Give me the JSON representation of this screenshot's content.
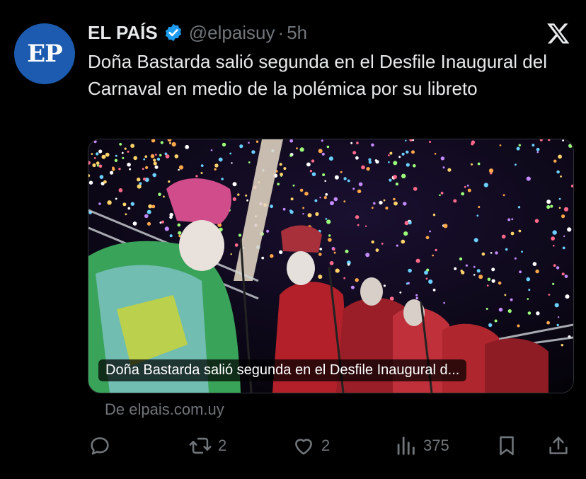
{
  "tweet": {
    "avatar_text": "EP",
    "author_name": "EL PAÍS",
    "handle": "@elpaisuy",
    "separator": "·",
    "time": "5h",
    "text": "Doña Bastarda salió segunda en el Desfile Inaugural del Carnaval en medio de la polémica por su libreto"
  },
  "card": {
    "title": "Doña Bastarda salió segunda en el Desfile Inaugural d...",
    "source": "De elpais.com.uy"
  },
  "actions": {
    "reply_count": "",
    "retweet_count": "2",
    "like_count": "2",
    "views_count": "375"
  },
  "colors": {
    "background": "#000000",
    "text": "#e7e9ea",
    "muted": "#71767b",
    "verified": "#1d9bf0",
    "avatar": "#1c5bb0"
  },
  "icons": [
    "verified-badge-icon",
    "x-logo-icon",
    "reply-icon",
    "retweet-icon",
    "like-icon",
    "views-icon",
    "bookmark-icon",
    "share-icon"
  ]
}
